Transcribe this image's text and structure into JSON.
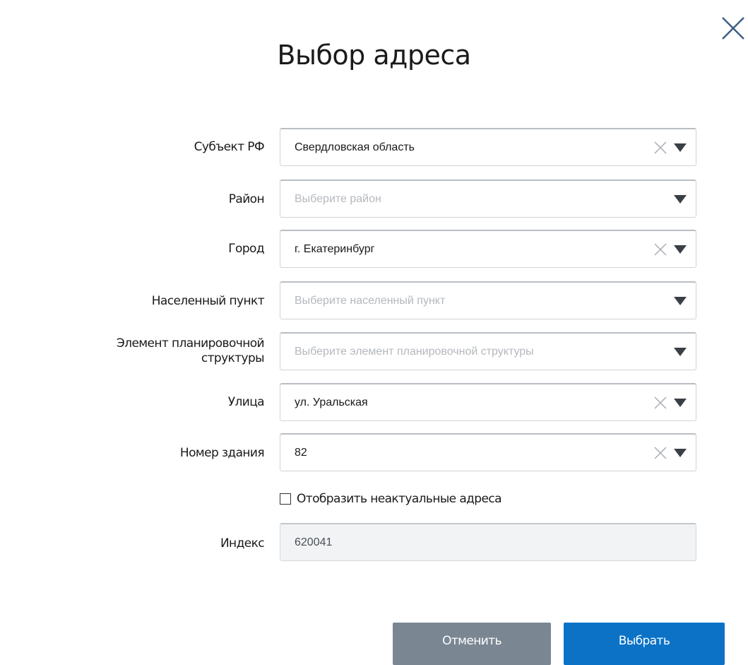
{
  "dialog": {
    "title": "Выбор адреса"
  },
  "fields": {
    "subject": {
      "label": "Субъект РФ",
      "value": "Свердловская область",
      "placeholder": ""
    },
    "district": {
      "label": "Район",
      "value": "",
      "placeholder": "Выберите район"
    },
    "city": {
      "label": "Город",
      "value": "г. Екатеринбург",
      "placeholder": ""
    },
    "locality": {
      "label": "Населенный пункт",
      "value": "",
      "placeholder": "Выберите населенный пункт"
    },
    "planning_element": {
      "label_line1": "Элемент планировочной",
      "label_line2": "структуры",
      "value": "",
      "placeholder": "Выберите элемент планировочной структуры"
    },
    "street": {
      "label": "Улица",
      "value": "ул. Уральская",
      "placeholder": ""
    },
    "building": {
      "label": "Номер здания",
      "value": "82",
      "placeholder": ""
    },
    "index": {
      "label": "Индекс",
      "value": "620041"
    }
  },
  "checkbox": {
    "label": "Отобразить неактуальные адреса",
    "checked": false
  },
  "buttons": {
    "cancel_label": "Отменить",
    "select_label": "Выбрать"
  },
  "colors": {
    "cancel_bg": "#7a8793",
    "select_bg": "#0b72c6",
    "placeholder": "#b4b8bd",
    "icon": "#a8adb3",
    "arrow": "#3a3f45"
  },
  "icons": {
    "close": "close-icon",
    "clear": "clear-icon",
    "dropdown": "caret-down-icon"
  }
}
